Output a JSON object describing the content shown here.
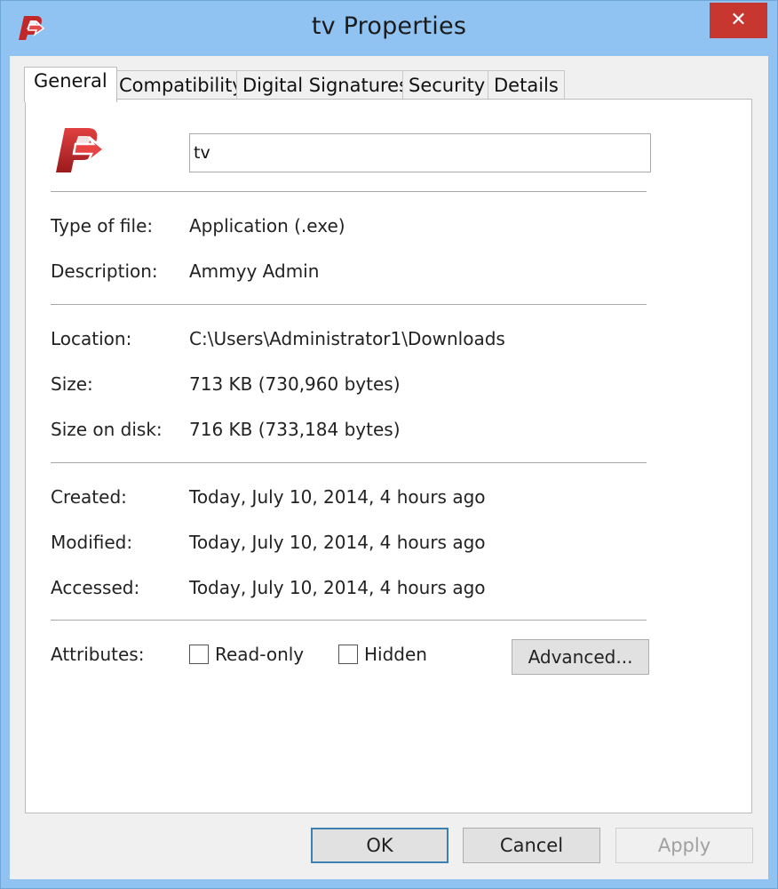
{
  "window": {
    "title": "tv Properties",
    "close_label": "✕"
  },
  "tabs": [
    {
      "label": "General",
      "active": true
    },
    {
      "label": "Compatibility",
      "active": false
    },
    {
      "label": "Digital Signatures",
      "active": false
    },
    {
      "label": "Security",
      "active": false
    },
    {
      "label": "Details",
      "active": false
    }
  ],
  "general": {
    "file_name": "tv",
    "type_label": "Type of file:",
    "type_value": "Application (.exe)",
    "description_label": "Description:",
    "description_value": "Ammyy Admin",
    "location_label": "Location:",
    "location_value": "C:\\Users\\Administrator1\\Downloads",
    "size_label": "Size:",
    "size_value": "713 KB (730,960 bytes)",
    "size_on_disk_label": "Size on disk:",
    "size_on_disk_value": "716 KB (733,184 bytes)",
    "created_label": "Created:",
    "created_value": "Today, July 10, 2014, 4 hours ago",
    "modified_label": "Modified:",
    "modified_value": "Today, July 10, 2014, 4 hours ago",
    "accessed_label": "Accessed:",
    "accessed_value": "Today, July 10, 2014, 4 hours ago",
    "attributes_label": "Attributes:",
    "readonly_label": "Read-only",
    "readonly_checked": false,
    "hidden_label": "Hidden",
    "hidden_checked": false,
    "advanced_label": "Advanced..."
  },
  "buttons": {
    "ok": "OK",
    "cancel": "Cancel",
    "apply": "Apply"
  },
  "colors": {
    "titlebar": "#90c3f2",
    "close": "#c7362f",
    "icon_red": "#c0282a"
  },
  "icons": {
    "app": "ammyy-admin-icon",
    "file": "ammyy-admin-icon"
  }
}
